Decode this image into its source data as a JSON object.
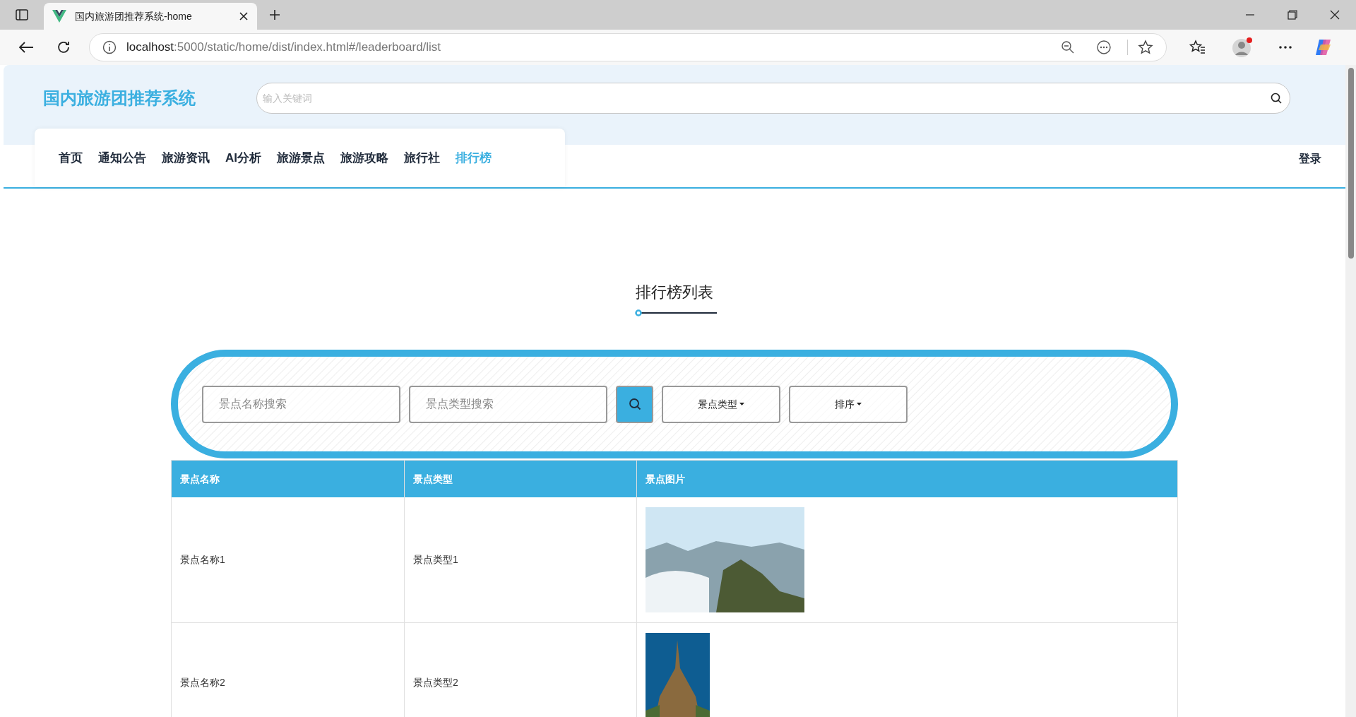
{
  "browser": {
    "tab_title": "国内旅游团推荐系统-home",
    "url_host": "localhost",
    "url_rest": ":5000/static/home/dist/index.html#/leaderboard/list"
  },
  "header": {
    "site_title": "国内旅游团推荐系统",
    "search": {
      "placeholder": "输入关键词"
    }
  },
  "nav": [
    {
      "label": "首页",
      "selected": false
    },
    {
      "label": "通知公告",
      "selected": false
    },
    {
      "label": "旅游资讯",
      "selected": false
    },
    {
      "label": "AI分析",
      "selected": false
    },
    {
      "label": "旅游景点",
      "selected": false
    },
    {
      "label": "旅游攻略",
      "selected": false
    },
    {
      "label": "旅行社",
      "selected": false
    },
    {
      "label": "排行榜",
      "selected": true
    }
  ],
  "login": "登录",
  "page_title": "排行榜列表",
  "filters": {
    "name_search": {
      "placeholder": "景点名称搜索"
    },
    "type_search": {
      "placeholder": "景点类型搜索"
    },
    "dropdowns": [
      "景点类型",
      "排序"
    ]
  },
  "table": {
    "columns": [
      "景点名称",
      "景点类型",
      "景点图片"
    ],
    "rows": [
      {
        "name": "景点名称1",
        "type": "景点类型1"
      },
      {
        "name": "景点名称2",
        "type": "景点类型2"
      }
    ]
  }
}
